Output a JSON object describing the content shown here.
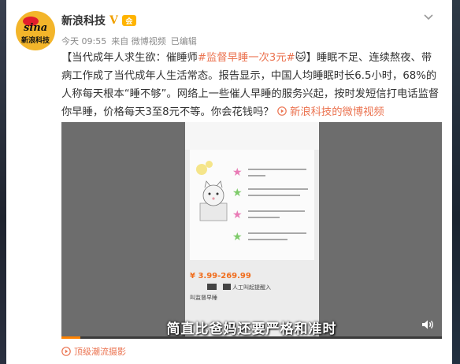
{
  "account": {
    "name": "新浪科技",
    "verified_badge": "V",
    "member_badge": "会",
    "avatar_logo_text": "sina",
    "avatar_brand_text": "新浪科技"
  },
  "meta": {
    "time": "今天 09:55",
    "source": "来自 微博视频",
    "edited": "已编辑"
  },
  "menu_icon": "chevron-down-icon",
  "post": {
    "prefix": "【当代成年人求生欲：催睡师",
    "hashtag": "#监督早睡一次3元#",
    "emoji": "🐱",
    "body": "】睡眠不足、连续熬夜、带病工作成了当代成年人生活常态。报告显示，中国人均睡眠时长6.5小时，68%的人称每天根本“睡不够”。网络上一些催人早睡的服务兴起，按时发短信打电话监督你早睡，价格每天3至8元不等。你会花钱吗？",
    "video_link": "新浪科技的微博视频",
    "video_link_icon": "play-circle-icon"
  },
  "video": {
    "price": "¥ 3.99-269.99",
    "tag_right": "人工叫起提醒入",
    "tag_left": "叫监督早睡",
    "subtitle": "简直比爸妈还要严格和准时",
    "volume_icon": "volume-icon",
    "progress": 0.05
  },
  "footer": {
    "text": "顶级潮流摄影",
    "icon": "play-circle-icon"
  },
  "colors": {
    "link": "#eb7350",
    "progress": "#ff8200",
    "avatar": "#f3b52a"
  }
}
